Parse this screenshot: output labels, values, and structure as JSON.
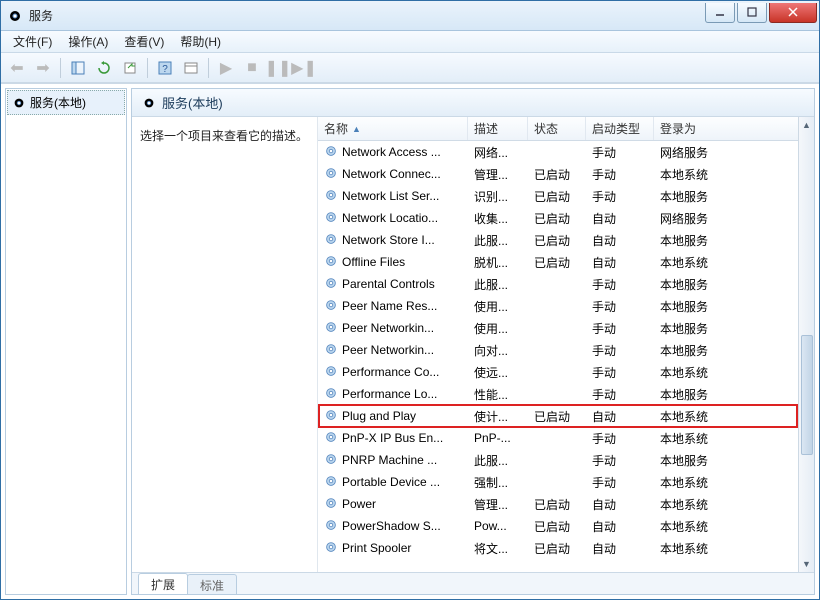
{
  "title": "服务",
  "menus": [
    "文件(F)",
    "操作(A)",
    "查看(V)",
    "帮助(H)"
  ],
  "left_tree": {
    "label": "服务(本地)"
  },
  "header_title": "服务(本地)",
  "desc_text": "选择一个项目来查看它的描述。",
  "columns": {
    "name": "名称",
    "desc": "描述",
    "status": "状态",
    "startup": "启动类型",
    "logon": "登录为"
  },
  "tabs": {
    "ext": "扩展",
    "std": "标准"
  },
  "highlighted_index": 12,
  "services": [
    {
      "name": "Network Access ...",
      "desc": "网络...",
      "status": "",
      "startup": "手动",
      "logon": "网络服务"
    },
    {
      "name": "Network Connec...",
      "desc": "管理...",
      "status": "已启动",
      "startup": "手动",
      "logon": "本地系统"
    },
    {
      "name": "Network List Ser...",
      "desc": "识别...",
      "status": "已启动",
      "startup": "手动",
      "logon": "本地服务"
    },
    {
      "name": "Network Locatio...",
      "desc": "收集...",
      "status": "已启动",
      "startup": "自动",
      "logon": "网络服务"
    },
    {
      "name": "Network Store I...",
      "desc": "此服...",
      "status": "已启动",
      "startup": "自动",
      "logon": "本地服务"
    },
    {
      "name": "Offline Files",
      "desc": "脱机...",
      "status": "已启动",
      "startup": "自动",
      "logon": "本地系统"
    },
    {
      "name": "Parental Controls",
      "desc": "此服...",
      "status": "",
      "startup": "手动",
      "logon": "本地服务"
    },
    {
      "name": "Peer Name Res...",
      "desc": "使用...",
      "status": "",
      "startup": "手动",
      "logon": "本地服务"
    },
    {
      "name": "Peer Networkin...",
      "desc": "使用...",
      "status": "",
      "startup": "手动",
      "logon": "本地服务"
    },
    {
      "name": "Peer Networkin...",
      "desc": "向对...",
      "status": "",
      "startup": "手动",
      "logon": "本地服务"
    },
    {
      "name": "Performance Co...",
      "desc": "使远...",
      "status": "",
      "startup": "手动",
      "logon": "本地系统"
    },
    {
      "name": "Performance Lo...",
      "desc": "性能...",
      "status": "",
      "startup": "手动",
      "logon": "本地服务"
    },
    {
      "name": "Plug and Play",
      "desc": "使计...",
      "status": "已启动",
      "startup": "自动",
      "logon": "本地系统"
    },
    {
      "name": "PnP-X IP Bus En...",
      "desc": "PnP-...",
      "status": "",
      "startup": "手动",
      "logon": "本地系统"
    },
    {
      "name": "PNRP Machine ...",
      "desc": "此服...",
      "status": "",
      "startup": "手动",
      "logon": "本地服务"
    },
    {
      "name": "Portable Device ...",
      "desc": "强制...",
      "status": "",
      "startup": "手动",
      "logon": "本地系统"
    },
    {
      "name": "Power",
      "desc": "管理...",
      "status": "已启动",
      "startup": "自动",
      "logon": "本地系统"
    },
    {
      "name": "PowerShadow S...",
      "desc": "Pow...",
      "status": "已启动",
      "startup": "自动",
      "logon": "本地系统"
    },
    {
      "name": "Print Spooler",
      "desc": "将文...",
      "status": "已启动",
      "startup": "自动",
      "logon": "本地系统"
    }
  ]
}
